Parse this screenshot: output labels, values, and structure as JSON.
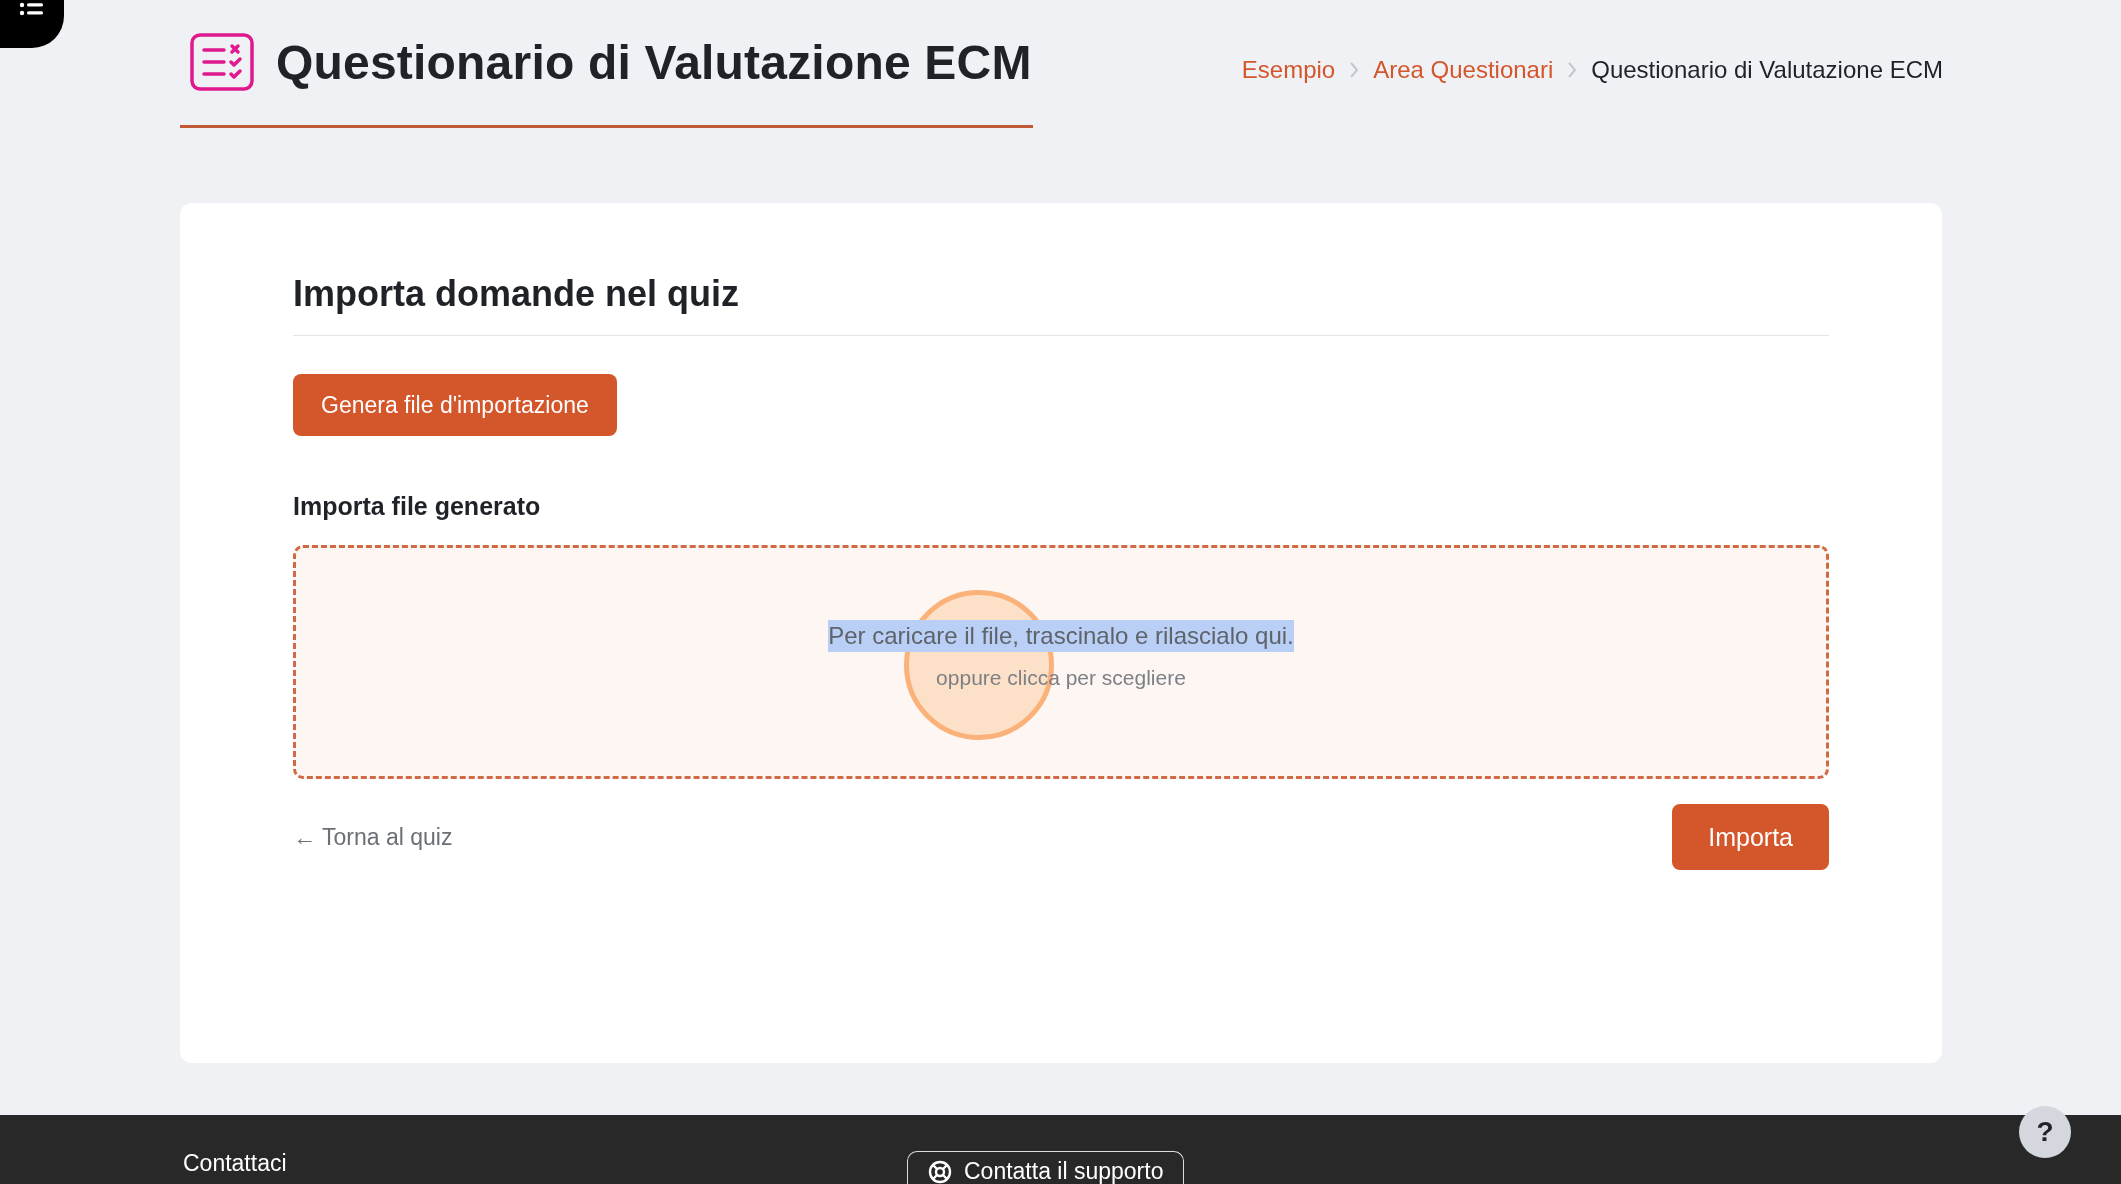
{
  "header": {
    "title": "Questionario di Valutazione ECM"
  },
  "breadcrumb": [
    {
      "label": "Esempio",
      "kind": "link"
    },
    {
      "label": "Area Questionari",
      "kind": "link"
    },
    {
      "label": "Questionario di Valutazione ECM",
      "kind": "current"
    }
  ],
  "card": {
    "heading": "Importa domande nel quiz",
    "generate_button": "Genera file d'importazione",
    "upload_label": "Importa file generato",
    "dropzone": {
      "instruction": "Per caricare il file, trascinalo e rilascialo qui.",
      "instruction_highlighted": true,
      "hint": "oppure clicca per scegliere"
    },
    "back_link": "← Torna al quiz",
    "submit_button": "Importa"
  },
  "footer": {
    "heading": "Contattaci",
    "support_button": "Contatta il supporto",
    "help_button": "?"
  }
}
